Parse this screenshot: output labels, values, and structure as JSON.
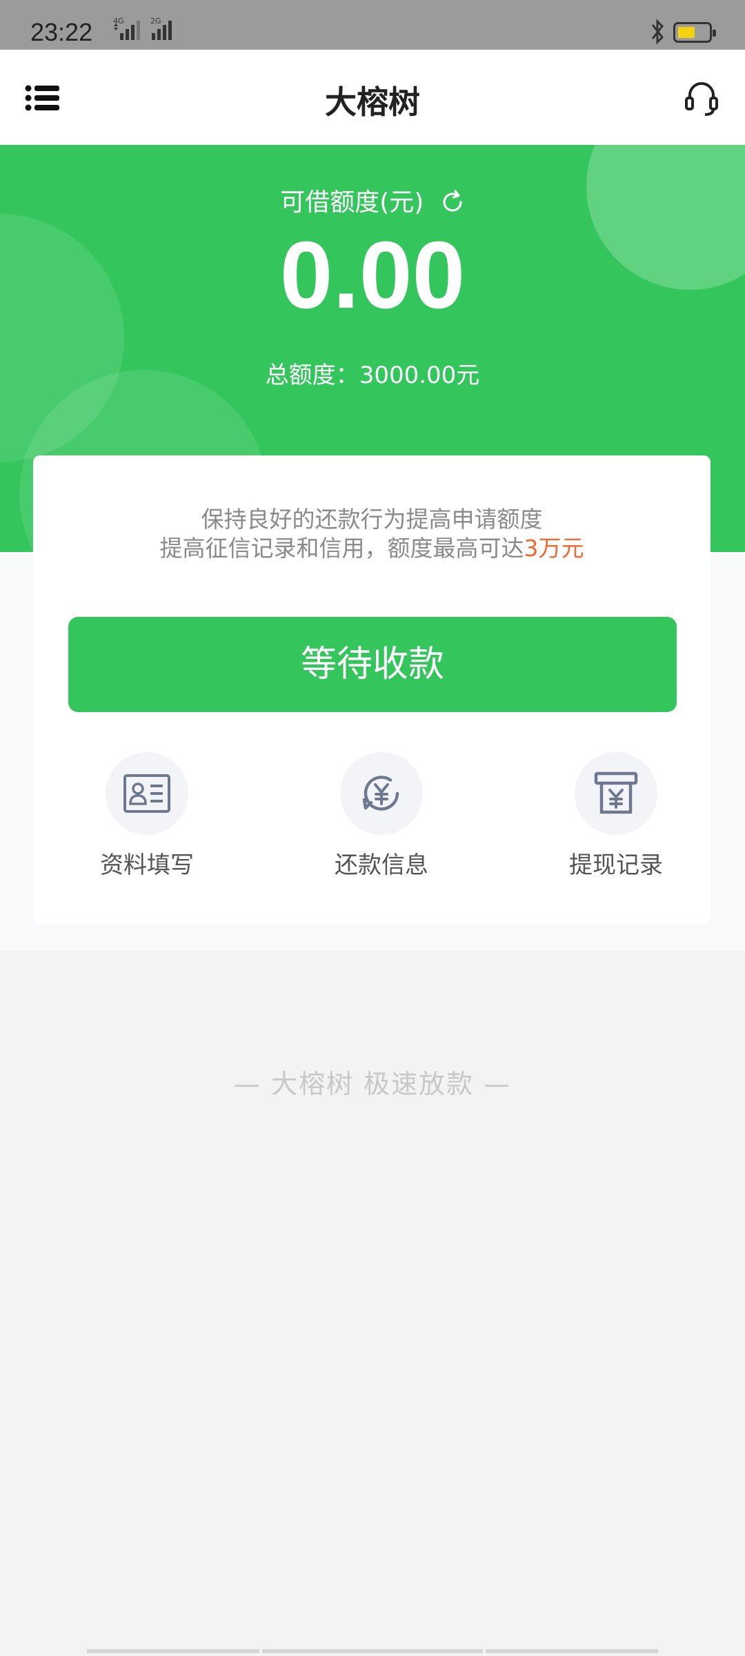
{
  "status_bar": {
    "time": "23:22",
    "signal_1_label": "4G",
    "signal_2_label": "2G",
    "icons": [
      "signal-4g-icon",
      "signal-2g-icon",
      "bluetooth-icon",
      "battery-icon"
    ]
  },
  "header": {
    "title": "大榕树",
    "menu_icon": "menu-icon",
    "support_icon": "headset-icon"
  },
  "hero": {
    "available_label": "可借额度(元)",
    "available_amount": "0.00",
    "total_label": "总额度：",
    "total_value": "3000.00元",
    "colors": {
      "green": "#34c65d",
      "highlight": "#ee6a2e"
    }
  },
  "card": {
    "tip_line1": "保持良好的还款行为提高申请额度",
    "tip_line2_prefix": "提高征信记录和信用，额度最高可达",
    "tip_line2_highlight": "3万元",
    "primary_button": "等待收款",
    "quick_actions": [
      {
        "label": "资料填写",
        "icon": "id-card-icon"
      },
      {
        "label": "还款信息",
        "icon": "yuan-refresh-icon"
      },
      {
        "label": "提现记录",
        "icon": "withdraw-record-icon"
      }
    ]
  },
  "footer": {
    "slogan": "— 大榕树  极速放款 —"
  }
}
